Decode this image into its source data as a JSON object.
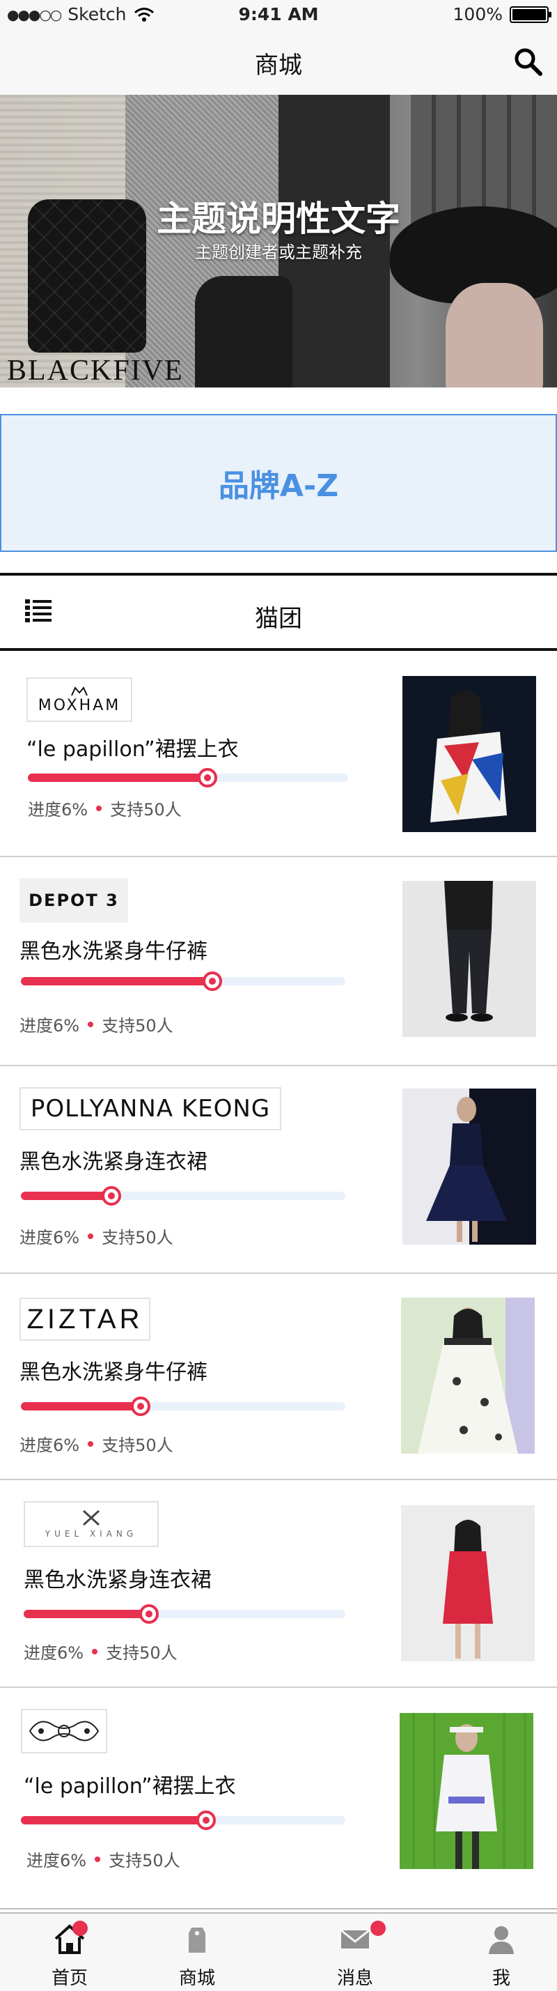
{
  "status_bar": {
    "carrier": "Sketch",
    "signal": "●●●○○",
    "time": "9:41 AM",
    "battery": "100%"
  },
  "nav": {
    "title": "商城",
    "search_icon": "search-icon"
  },
  "banner": {
    "title": "主题说明性文字",
    "subtitle": "主题创建者或主题补充",
    "brand_text": "BLACKFIVE"
  },
  "brand_az": {
    "label": "品牌A-Z"
  },
  "group": {
    "title": "猫团",
    "icon": "list-icon"
  },
  "products": [
    {
      "brand": "MOXHAM",
      "name": "“le papillon”裙摆上衣",
      "progress": 0.56,
      "meta_progress": "进度6%",
      "meta_support": "支持50人"
    },
    {
      "brand": "DEPOT 3",
      "name": "黑色水洗紧身牛仔裤",
      "progress": 0.59,
      "meta_progress": "进度6%",
      "meta_support": "支持50人"
    },
    {
      "brand": "POLLYANNA  KEONG",
      "name": "黑色水洗紧身连衣裙",
      "progress": 0.28,
      "meta_progress": "进度6%",
      "meta_support": "支持50人"
    },
    {
      "brand": "ZIZTAR",
      "name": "黑色水洗紧身牛仔裤",
      "progress": 0.37,
      "meta_progress": "进度6%",
      "meta_support": "支持50人"
    },
    {
      "brand": "YUEL XIANG",
      "name": "黑色水洗紧身连衣裙",
      "progress": 0.39,
      "meta_progress": "进度6%",
      "meta_support": "支持50人"
    },
    {
      "brand": "",
      "name": "“le papillon”裙摆上衣",
      "progress": 0.57,
      "meta_progress": "进度6%",
      "meta_support": "支持50人"
    }
  ],
  "tabbar": [
    {
      "label": "首页",
      "icon": "home-icon",
      "badge": true
    },
    {
      "label": "商城",
      "icon": "tag-icon",
      "badge": false
    },
    {
      "label": "消息",
      "icon": "mail-icon",
      "badge": true
    },
    {
      "label": "我",
      "icon": "user-icon",
      "badge": false
    }
  ],
  "colors": {
    "accent": "#e8304f",
    "brand_blue": "#4a90e2",
    "brand_bg": "#e9f1fb"
  }
}
